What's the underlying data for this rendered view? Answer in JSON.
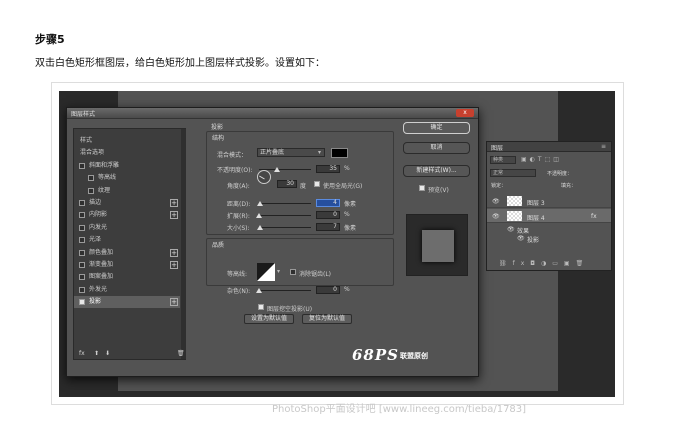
{
  "step": "步骤5",
  "description": "双击白色矩形框图层，给白色矩形加上图层样式投影。设置如下：",
  "dialog": {
    "title": "图层样式",
    "close": "x",
    "left_items": [
      {
        "label": "样式",
        "checkbox": false,
        "plus": false,
        "indent": false
      },
      {
        "label": "混合选项",
        "checkbox": false,
        "plus": false,
        "indent": false
      },
      {
        "label": "斜面和浮雕",
        "checkbox": true,
        "checked": false,
        "plus": false,
        "indent": false
      },
      {
        "label": "等高线",
        "checkbox": true,
        "checked": false,
        "plus": false,
        "indent": true
      },
      {
        "label": "纹理",
        "checkbox": true,
        "checked": false,
        "plus": false,
        "indent": true
      },
      {
        "label": "描边",
        "checkbox": true,
        "checked": false,
        "plus": true,
        "indent": false
      },
      {
        "label": "内阴影",
        "checkbox": true,
        "checked": false,
        "plus": true,
        "indent": false
      },
      {
        "label": "内发光",
        "checkbox": true,
        "checked": false,
        "plus": false,
        "indent": false
      },
      {
        "label": "光泽",
        "checkbox": true,
        "checked": false,
        "plus": false,
        "indent": false
      },
      {
        "label": "颜色叠加",
        "checkbox": true,
        "checked": false,
        "plus": true,
        "indent": false
      },
      {
        "label": "渐变叠加",
        "checkbox": true,
        "checked": false,
        "plus": true,
        "indent": false
      },
      {
        "label": "图案叠加",
        "checkbox": true,
        "checked": false,
        "plus": false,
        "indent": false
      },
      {
        "label": "外发光",
        "checkbox": true,
        "checked": false,
        "plus": false,
        "indent": false
      },
      {
        "label": "投影",
        "checkbox": true,
        "checked": true,
        "plus": true,
        "indent": false,
        "selected": true
      }
    ],
    "footer_fx": "fx",
    "drop_shadow": {
      "title": "投影",
      "structure": "结构",
      "blend_mode_label": "混合模式：",
      "blend_mode": "正片叠底",
      "opacity_label": "不透明度(O):",
      "opacity": "35",
      "opacity_level": 35,
      "percent": "%",
      "angle_label": "角度(A):",
      "angle": "30",
      "degree": "度",
      "global_light": "使用全局光(G)",
      "distance_label": "距离(D):",
      "distance": "4",
      "distance_level": 4,
      "pixels": "像素",
      "spread_label": "扩展(R):",
      "spread": "0",
      "spread_level": 0,
      "size_label": "大小(S):",
      "size": "7",
      "size_level": 7,
      "quality": "品质",
      "contour_label": "等高线:",
      "antialias": "消除锯齿(L)",
      "noise_label": "杂色(N):",
      "noise": "0",
      "noise_level": 0,
      "knockout": "图层挖空投影(U)",
      "set_default": "设置为默认值",
      "reset_default": "复位为默认值"
    },
    "buttons": {
      "ok": "确定",
      "cancel": "取消",
      "new_style": "新建样式(W)...",
      "preview": "预览(V)"
    }
  },
  "logo": {
    "brand": "68PS",
    "sub": "联盟原创"
  },
  "layers_panel": {
    "title": "图层",
    "filter": "种类",
    "mode": "正常",
    "opacity": "不透明度：",
    "lock": "锁定：",
    "fill": "填充：",
    "layers": [
      {
        "name": "图层 3",
        "selected": false
      },
      {
        "name": "图层 4",
        "selected": true,
        "fx": "fx"
      }
    ],
    "effects_label": "效果",
    "effect_item": "投影"
  },
  "watermark": "PhotoShop平面设计吧 [www.lineeg.com/tieba/1783]"
}
